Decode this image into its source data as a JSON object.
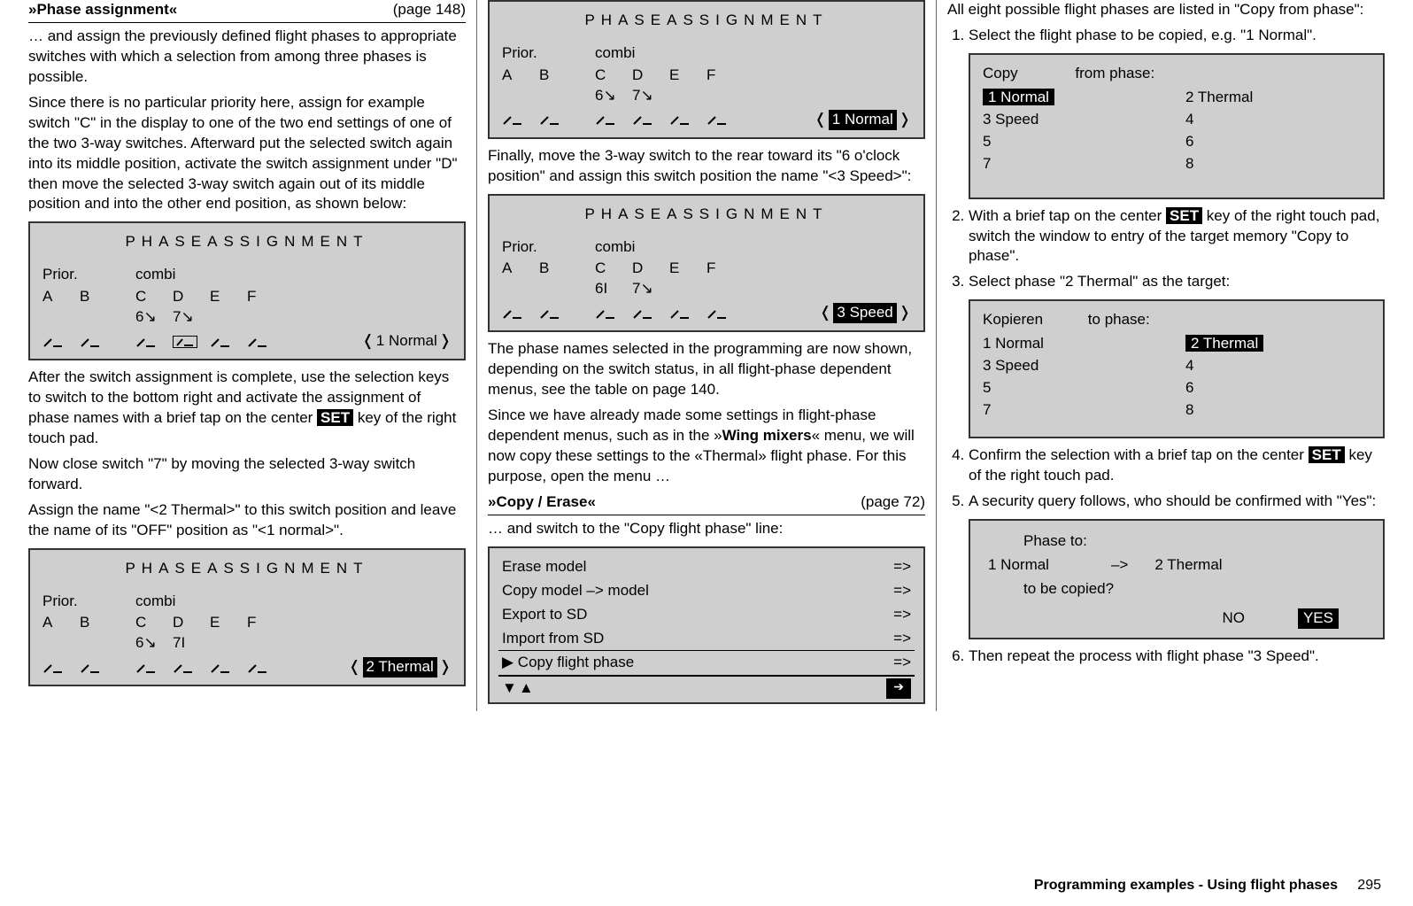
{
  "col1": {
    "heading_title": "»Phase assignment«",
    "heading_page": "(page 148)",
    "p1": "… and assign the previously defined flight phases to appropriate switches with which a selection from among three phases is possible.",
    "p2": "Since there is no particular priority here, assign for example switch \"C\" in the display to one of the two end settings of one of the two 3-way switches. Afterward put the selected switch again into its middle position, activate the switch assignment under \"D\" then move the selected 3-way switch again out of its middle position and into the other end position, as shown below:",
    "p3a": "After the switch assignment is complete, use the selection keys to switch to the bottom right and activate the assignment of phase names with a brief tap on the center ",
    "p3_set": "SET",
    "p3b": " key of the right touch pad.",
    "p4": "Now close switch \"7\" by moving the selected 3-way switch forward.",
    "p5": "Assign the name \"<2 Thermal>\" to this switch position and leave the name of its \"OFF\" position as \"<1 normal>\"."
  },
  "col2": {
    "p1": "Finally, move the 3-way switch to the rear toward its \"6 o'clock position\" and assign this switch position the name \"<3 Speed>\":",
    "p2": "The phase names selected in the programming are now shown, depending on the switch status, in all flight-phase dependent menus, see the table on page 140.",
    "p3a": "Since we have already made some settings in flight-phase dependent menus, such as in the »",
    "p3_bold": "Wing mixers",
    "p3b": "« menu, we will now copy these settings to the «Thermal» flight phase. For this purpose, open the menu …",
    "heading_title": "»Copy / Erase«",
    "heading_page": "(page 72)",
    "p4": "… and switch to the \"Copy flight phase\" line:",
    "menu": {
      "items": [
        {
          "label": "Erase model",
          "arrow": "=>"
        },
        {
          "label": "Copy model –> model",
          "arrow": "=>"
        },
        {
          "label": "Export to SD",
          "arrow": "=>"
        },
        {
          "label": "Import from SD",
          "arrow": "=>"
        }
      ],
      "selected_label": "Copy flight phase",
      "selected_arrow": "=>"
    }
  },
  "col3": {
    "p0": "All eight possible flight phases are listed in \"Copy from phase\":",
    "li1": "Select the flight phase to be copied, e.g. \"1 Normal\".",
    "copyfrom": {
      "hdr_left": "Copy",
      "hdr_right": "from phase:",
      "rows": [
        [
          "1 Normal",
          "2 Thermal"
        ],
        [
          "3 Speed",
          "4"
        ],
        [
          "5",
          "6"
        ],
        [
          "7",
          "8"
        ]
      ]
    },
    "li2a": "With a brief tap on the center ",
    "li2_set": "SET",
    "li2b": " key of the right touch pad, switch the window to entry of the target memory \"Copy to phase\".",
    "li3": "Select phase \"2 Thermal\" as the target:",
    "copyto": {
      "hdr_left": "Kopieren",
      "hdr_right": "to phase:",
      "rows": [
        [
          "1 Normal",
          "2 Thermal"
        ],
        [
          "3 Speed",
          "4"
        ],
        [
          "5",
          "6"
        ],
        [
          "7",
          "8"
        ]
      ]
    },
    "li4a": "Confirm the selection with a brief tap on the center ",
    "li4_set": "SET",
    "li4b": " key of the right touch pad.",
    "li5": "A security query follows, who should be confirmed with \"Yes\":",
    "confirm": {
      "l1": "Phase to:",
      "l2_left": "1  Normal",
      "l2_mid": "–>",
      "l2_right": "2  Thermal",
      "l3": "to be copied?",
      "no": "NO",
      "yes": "YES"
    },
    "li6": "Then repeat the process with flight phase \"3 Speed\"."
  },
  "lcd": {
    "title": "PHASEASSIGNMENT",
    "prior": "Prior.",
    "combi": "combi",
    "cols": [
      "A",
      "B",
      "C",
      "D",
      "E",
      "F"
    ],
    "sw6o": "6↘",
    "sw7o": "7↘",
    "sw6c": "6I",
    "sw7c": "7I",
    "sw7half": "7↘",
    "phase1": "1 Normal",
    "phase2": "2 Thermal",
    "phase3": "3 Speed",
    "angle_l": "❬",
    "angle_r": "❭"
  },
  "footer": {
    "title": "Programming examples - Using flight phases",
    "page": "295"
  }
}
